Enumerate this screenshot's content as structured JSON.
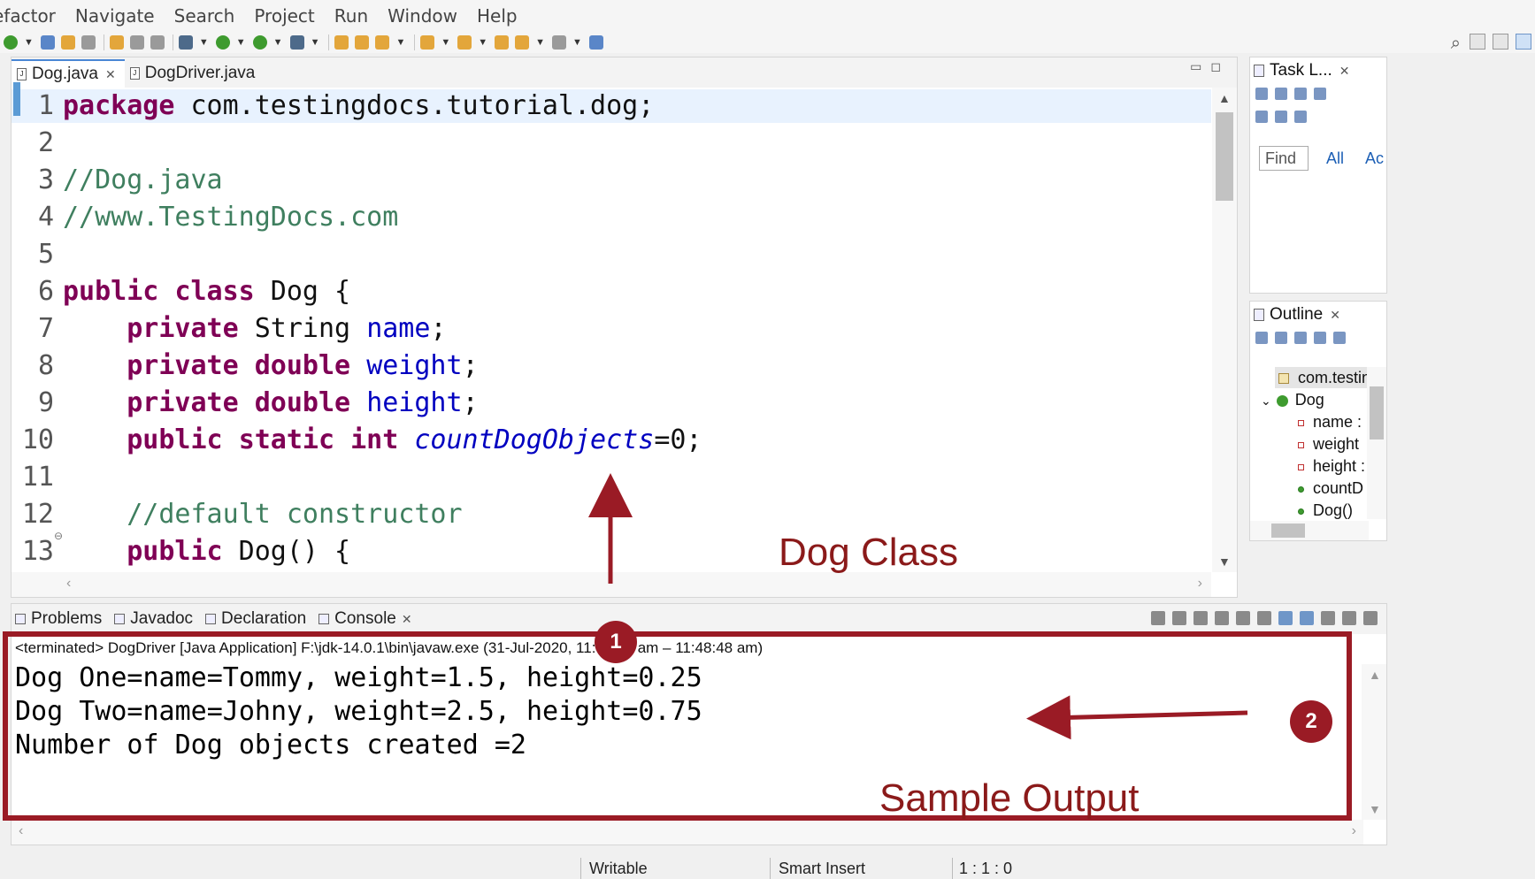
{
  "menu": [
    "efactor",
    "Navigate",
    "Search",
    "Project",
    "Run",
    "Window",
    "Help"
  ],
  "editor": {
    "tabs": [
      {
        "label": "Dog.java",
        "active": true
      },
      {
        "label": "DogDriver.java",
        "active": false
      }
    ],
    "lines": [
      {
        "n": "1",
        "tokens": [
          {
            "t": "package",
            "c": "kw"
          },
          {
            "t": " com.testingdocs.tutorial.dog;",
            "c": ""
          }
        ]
      },
      {
        "n": "2",
        "tokens": []
      },
      {
        "n": "3",
        "tokens": [
          {
            "t": "//Dog.java",
            "c": "cm"
          }
        ]
      },
      {
        "n": "4",
        "tokens": [
          {
            "t": "//www.TestingDocs.com",
            "c": "cm"
          }
        ]
      },
      {
        "n": "5",
        "tokens": []
      },
      {
        "n": "6",
        "tokens": [
          {
            "t": "public",
            "c": "kw"
          },
          {
            "t": " ",
            "c": ""
          },
          {
            "t": "class",
            "c": "kw"
          },
          {
            "t": " Dog {",
            "c": ""
          }
        ]
      },
      {
        "n": "7",
        "tokens": [
          {
            "t": "    ",
            "c": ""
          },
          {
            "t": "private",
            "c": "kw"
          },
          {
            "t": " String ",
            "c": ""
          },
          {
            "t": "name",
            "c": "fld"
          },
          {
            "t": ";",
            "c": ""
          }
        ]
      },
      {
        "n": "8",
        "tokens": [
          {
            "t": "    ",
            "c": ""
          },
          {
            "t": "private",
            "c": "kw"
          },
          {
            "t": " ",
            "c": ""
          },
          {
            "t": "double",
            "c": "kw"
          },
          {
            "t": " ",
            "c": ""
          },
          {
            "t": "weight",
            "c": "fld"
          },
          {
            "t": ";",
            "c": ""
          }
        ]
      },
      {
        "n": "9",
        "tokens": [
          {
            "t": "    ",
            "c": ""
          },
          {
            "t": "private",
            "c": "kw"
          },
          {
            "t": " ",
            "c": ""
          },
          {
            "t": "double",
            "c": "kw"
          },
          {
            "t": " ",
            "c": ""
          },
          {
            "t": "height",
            "c": "fld"
          },
          {
            "t": ";",
            "c": ""
          }
        ]
      },
      {
        "n": "10",
        "tokens": [
          {
            "t": "    ",
            "c": ""
          },
          {
            "t": "public",
            "c": "kw"
          },
          {
            "t": " ",
            "c": ""
          },
          {
            "t": "static",
            "c": "kw"
          },
          {
            "t": " ",
            "c": ""
          },
          {
            "t": "int",
            "c": "kw"
          },
          {
            "t": " ",
            "c": ""
          },
          {
            "t": "countDogObjects",
            "c": "sfld"
          },
          {
            "t": "=0;",
            "c": ""
          }
        ]
      },
      {
        "n": "11",
        "tokens": []
      },
      {
        "n": "12",
        "tokens": [
          {
            "t": "    ",
            "c": ""
          },
          {
            "t": "//default constructor",
            "c": "cm"
          }
        ]
      },
      {
        "n": "13",
        "tokens": [
          {
            "t": "    ",
            "c": ""
          },
          {
            "t": "public",
            "c": "kw"
          },
          {
            "t": " Dog() {",
            "c": ""
          }
        ]
      }
    ]
  },
  "task_list": {
    "title": "Task L...",
    "find_placeholder": "Find",
    "all_label": "All",
    "activate_label": "Ac"
  },
  "outline": {
    "title": "Outline",
    "package": "com.testin",
    "class_name": "Dog",
    "members": [
      "name :",
      "weight",
      "height :",
      "countD",
      "Dog()"
    ]
  },
  "bottom_tabs": [
    "Problems",
    "Javadoc",
    "Declaration",
    "Console"
  ],
  "console": {
    "terminated_line": "<terminated> DogDriver [Java Application] F:\\jdk-14.0.1\\bin\\javaw.exe  (31-Jul-2020, 11:48:48 am – 11:48:48 am)",
    "output": [
      "Dog One=name=Tommy, weight=1.5, height=0.25",
      "Dog Two=name=Johny, weight=2.5, height=0.75",
      "Number of Dog objects created =2"
    ]
  },
  "annotations": {
    "dog_class_label": "Dog Class",
    "sample_output_label": "Sample Output",
    "badge_1": "1",
    "badge_2": "2",
    "color": "#9a1b25"
  },
  "status": {
    "writable": "Writable",
    "insert_mode": "Smart Insert",
    "position": "1 : 1 : 0"
  }
}
